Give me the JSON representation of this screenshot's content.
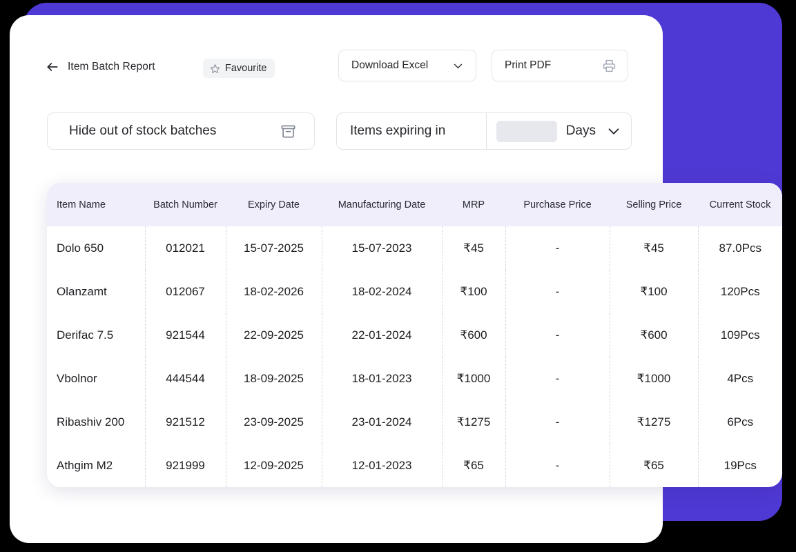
{
  "theme": {
    "accent_purple": "#4F39D4",
    "table_header_bg": "#EFEEFA",
    "chip_bg": "#F2F3F5",
    "input_bg": "#E7E8EE",
    "border": "#E2E4E9",
    "text": "#26272B",
    "page_bg": "#000000"
  },
  "header": {
    "back_icon": "arrow-left-icon",
    "title": "Item Batch Report",
    "favourite": {
      "icon": "star-icon",
      "label": "Favourite"
    },
    "download_excel": {
      "label": "Download Excel",
      "icon": "chevron-down-icon"
    },
    "print_pdf": {
      "label": "Print PDF",
      "icon": "printer-icon"
    }
  },
  "filters": {
    "hide_out_of_stock": {
      "label": "Hide out of stock batches",
      "icon": "archive-box-icon"
    },
    "expiring": {
      "label": "Items expiring in",
      "days_value": "",
      "days_placeholder": "",
      "unit_label": "Days",
      "icon": "chevron-down-icon"
    }
  },
  "table": {
    "columns": [
      "Item Name",
      "Batch Number",
      "Expiry Date",
      "Manufacturing Date",
      "MRP",
      "Purchase Price",
      "Selling Price",
      "Current Stock"
    ],
    "rows": [
      {
        "item_name": "Dolo 650",
        "batch_number": "012021",
        "expiry_date": "15-07-2025",
        "manufacturing_date": "15-07-2023",
        "mrp": "₹45",
        "purchase_price": "-",
        "selling_price": "₹45",
        "current_stock": "87.0Pcs"
      },
      {
        "item_name": "Olanzamt",
        "batch_number": "012067",
        "expiry_date": "18-02-2026",
        "manufacturing_date": "18-02-2024",
        "mrp": "₹100",
        "purchase_price": "-",
        "selling_price": "₹100",
        "current_stock": "120Pcs"
      },
      {
        "item_name": "Derifac 7.5",
        "batch_number": "921544",
        "expiry_date": "22-09-2025",
        "manufacturing_date": "22-01-2024",
        "mrp": "₹600",
        "purchase_price": "-",
        "selling_price": "₹600",
        "current_stock": "109Pcs"
      },
      {
        "item_name": "Vbolnor",
        "batch_number": "444544",
        "expiry_date": "18-09-2025",
        "manufacturing_date": "18-01-2023",
        "mrp": "₹1000",
        "purchase_price": "-",
        "selling_price": "₹1000",
        "current_stock": "4Pcs"
      },
      {
        "item_name": "Ribashiv 200",
        "batch_number": "921512",
        "expiry_date": "23-09-2025",
        "manufacturing_date": "23-01-2024",
        "mrp": "₹1275",
        "purchase_price": "-",
        "selling_price": "₹1275",
        "current_stock": "6Pcs"
      },
      {
        "item_name": "Athgim M2",
        "batch_number": "921999",
        "expiry_date": "12-09-2025",
        "manufacturing_date": "12-01-2023",
        "mrp": "₹65",
        "purchase_price": "-",
        "selling_price": "₹65",
        "current_stock": "19Pcs"
      }
    ]
  }
}
